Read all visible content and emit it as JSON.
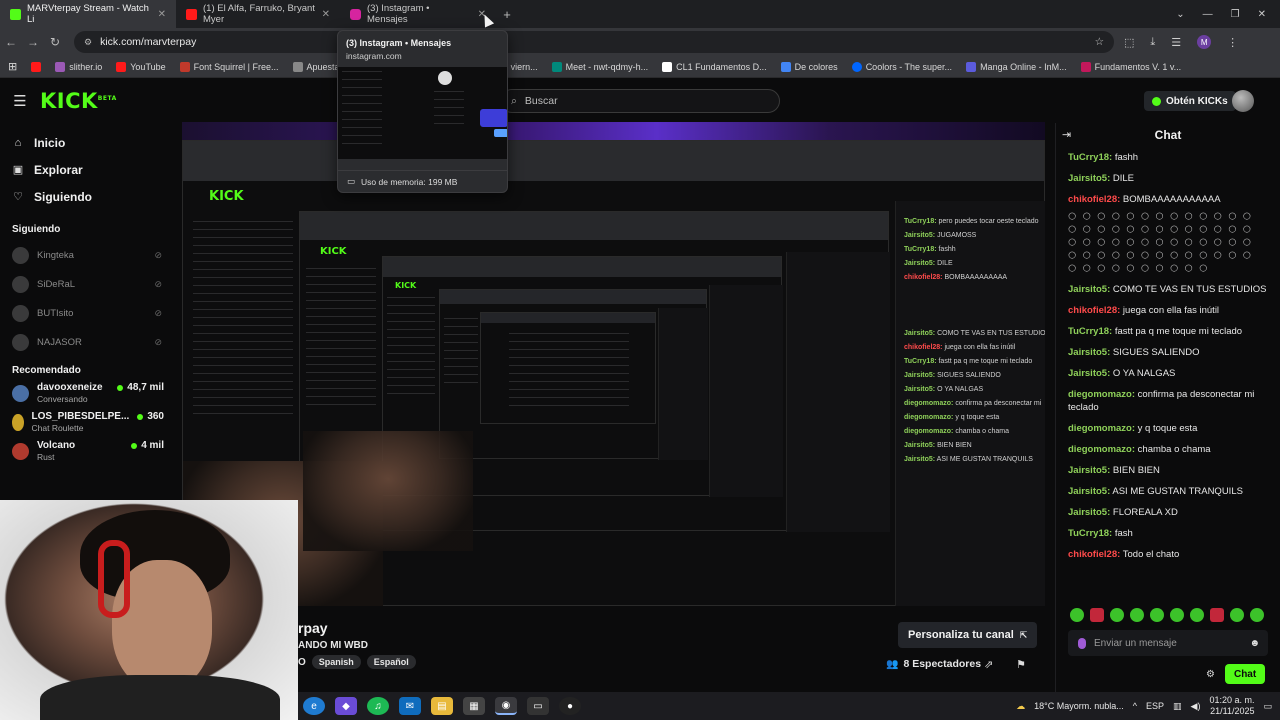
{
  "browser": {
    "tabs": [
      {
        "title": "MARVterpay Stream - Watch Li",
        "color": "#53fc18"
      },
      {
        "title": "(1) El Alfa, Farruko, Bryant Myer",
        "color": "#ff1a1a"
      },
      {
        "title": "(3) Instagram • Mensajes",
        "color": "#d6249f"
      }
    ],
    "url": "kick.com/marvterpay",
    "profile_initial": "M",
    "bookmarks": [
      {
        "label": "",
        "color": "#ff1a1a"
      },
      {
        "label": "slither.io",
        "color": "#9b59b6"
      },
      {
        "label": "YouTube",
        "color": "#ff1a1a"
      },
      {
        "label": "Font Squirrel | Free...",
        "color": "#c0392b"
      },
      {
        "label": "Apuestas dep",
        "color": "#888888"
      },
      {
        "label": "amentos viern...",
        "color": "#3c7ff0"
      },
      {
        "label": "Meet - nwt-qdmy-h...",
        "color": "#00897b"
      },
      {
        "label": "CL1 Fundamentos D...",
        "color": "#ffffff"
      },
      {
        "label": "De colores",
        "color": "#4285f4"
      },
      {
        "label": "Coolors - The super...",
        "color": "#0066ff"
      },
      {
        "label": "Manga Online - InM...",
        "color": "#5b5bdc"
      },
      {
        "label": "Fundamentos V. 1 v...",
        "color": "#c2185b"
      }
    ],
    "hovercard": {
      "title": "(3) Instagram • Mensajes",
      "domain": "instagram.com",
      "memory": "Uso de memoria: 199 MB"
    }
  },
  "kick": {
    "logo": "KICK",
    "logo_sup": "BETA",
    "search_placeholder": "Buscar",
    "kicks_button": "Obtén KICKs",
    "nav": [
      {
        "label": "Inicio",
        "icon": "home-icon",
        "glyph": "⌂"
      },
      {
        "label": "Explorar",
        "icon": "compass-icon",
        "glyph": "▣"
      },
      {
        "label": "Siguiendo",
        "icon": "heart-icon",
        "glyph": "♡"
      }
    ],
    "following_title": "Siguiendo",
    "following": [
      "Kingteka",
      "SiDeRaL",
      "BUTIsito",
      "NAJASOR"
    ],
    "recommended_title": "Recomendado",
    "recommended": [
      {
        "name": "davooxeneize",
        "category": "Conversando",
        "viewers": "48,7 mil",
        "color": "#4a6fa5"
      },
      {
        "name": "LOS_PIBESDELPE...",
        "category": "Chat Roulette",
        "viewers": "360",
        "color": "#c9a227"
      },
      {
        "name": "Volcano",
        "category": "Rust",
        "viewers": "4 mil",
        "color": "#b03a2e"
      }
    ],
    "channel": {
      "name": "rpay",
      "title": "ANDO MI WBD",
      "tags_prefix": "O",
      "tags": [
        "Spanish",
        "Español"
      ],
      "customize_button": "Personaliza tu canal",
      "viewers": "8 Espectadores"
    }
  },
  "chat": {
    "title": "Chat",
    "messages": [
      {
        "user": "TuCrry18:",
        "text": "fashh",
        "red": false
      },
      {
        "user": "Jairsito5:",
        "text": "DILE",
        "red": false
      },
      {
        "user": "chikofiel28:",
        "text": "BOMBAAAAAAAAAAA",
        "red": true
      },
      {
        "user": "Jairsito5:",
        "text": "COMO TE VAS EN TUS ESTUDIOS",
        "red": false
      },
      {
        "user": "chikofiel28:",
        "text": "juega con ella fas inútil",
        "red": true
      },
      {
        "user": "TuCrry18:",
        "text": "fastt pa q me toque mi teclado",
        "red": false
      },
      {
        "user": "Jairsito5:",
        "text": "SIGUES SALIENDO",
        "red": false
      },
      {
        "user": "Jairsito5:",
        "text": "O YA NALGAS",
        "red": false
      },
      {
        "user": "diegomomazo:",
        "text": "confirma pa desconectar mi teclado",
        "red": false
      },
      {
        "user": "diegomomazo:",
        "text": "y q toque esta",
        "red": false
      },
      {
        "user": "diegomomazo:",
        "text": "chamba o chama",
        "red": false
      },
      {
        "user": "Jairsito5:",
        "text": "BIEN BIEN",
        "red": false
      },
      {
        "user": "Jairsito5:",
        "text": "ASI ME GUSTAN TRANQUILS",
        "red": false
      },
      {
        "user": "Jairsito5:",
        "text": "FLOREALA XD",
        "red": false
      },
      {
        "user": "TuCrry18:",
        "text": "fash",
        "red": false
      },
      {
        "user": "chikofiel28:",
        "text": "Todo el chato",
        "red": true
      }
    ],
    "input_placeholder": "Enviar un mensaje",
    "send_button": "Chat"
  },
  "taskbar": {
    "weather": "18°C  Mayorm. nubla...",
    "lang": "ESP",
    "time": "01:20 a. m.",
    "date": "21/11/2025"
  }
}
